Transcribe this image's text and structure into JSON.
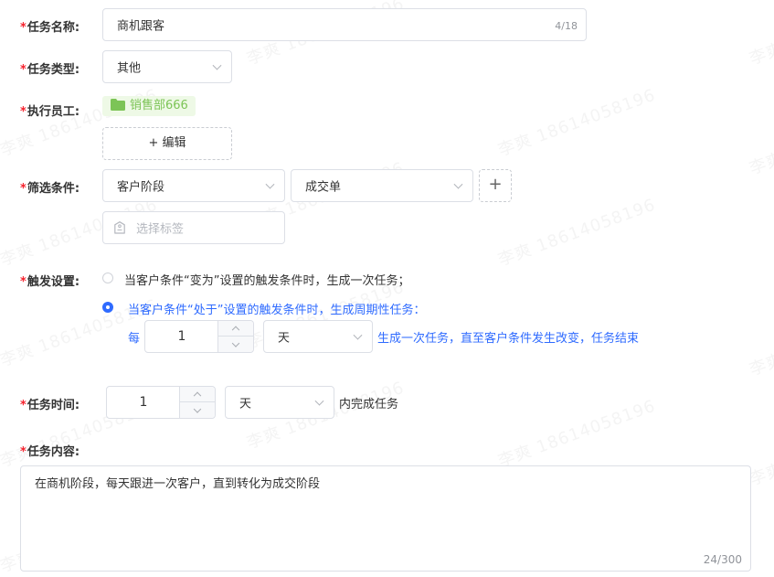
{
  "watermark": "李爽 18614058196",
  "task_name": {
    "label": "任务名称:",
    "value": "商机跟客",
    "counter": "4/18"
  },
  "task_type": {
    "label": "任务类型:",
    "value": "其他"
  },
  "executor": {
    "label": "执行员工:",
    "tag": "销售部666",
    "edit_label": "+ 编辑"
  },
  "filter": {
    "label": "筛选条件:",
    "field": "客户阶段",
    "value": "成交单",
    "add_symbol": "+",
    "tag_placeholder": "选择标签"
  },
  "trigger": {
    "label": "触发设置:",
    "options": [
      {
        "text": "当客户条件“变为”设置的触发条件时，生成一次任务；",
        "selected": false
      },
      {
        "text": "当客户条件“处于”设置的触发条件时，生成周期性任务：",
        "selected": true
      }
    ],
    "every_prefix": "每",
    "every_value": "1",
    "every_unit": "天",
    "every_suffix": "生成一次任务，直至客户条件发生改变，任务结束"
  },
  "task_time": {
    "label": "任务时间:",
    "value": "1",
    "unit": "天",
    "suffix": "内完成任务"
  },
  "task_content": {
    "label": "任务内容:",
    "value": "在商机阶段，每天跟进一次客户，直到转化为成交阶段",
    "counter": "24/300"
  },
  "colors": {
    "required_star": "#f5222d",
    "primary": "#2f6bff",
    "tag_text": "#7cc456",
    "tag_bg": "#eef9e6"
  }
}
